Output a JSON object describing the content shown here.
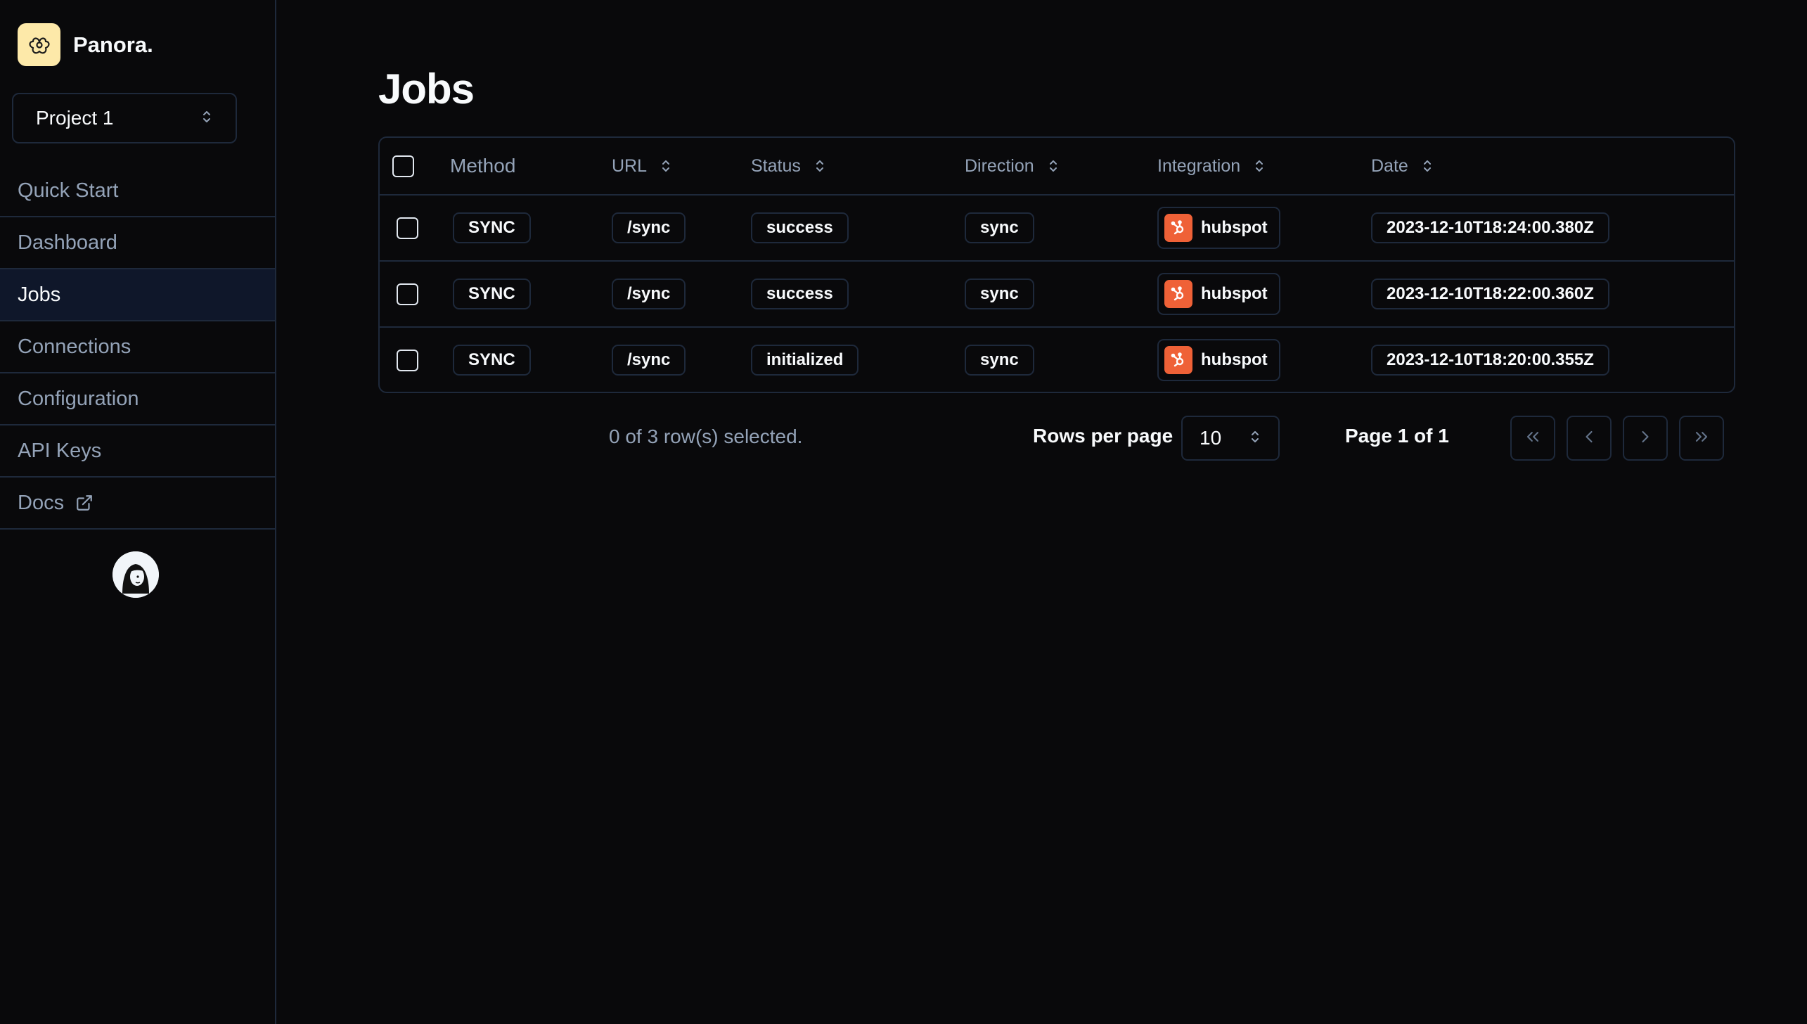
{
  "brand": {
    "name": "Panora."
  },
  "project_select": {
    "value": "Project 1"
  },
  "nav": {
    "items": [
      {
        "label": "Quick Start"
      },
      {
        "label": "Dashboard"
      },
      {
        "label": "Jobs",
        "active": true
      },
      {
        "label": "Connections"
      },
      {
        "label": "Configuration"
      },
      {
        "label": "API Keys"
      },
      {
        "label": "Docs",
        "icon": "external-link-icon"
      }
    ]
  },
  "page": {
    "title": "Jobs"
  },
  "table": {
    "columns": {
      "method": "Method",
      "url": "URL",
      "status": "Status",
      "direction": "Direction",
      "integration": "Integration",
      "date": "Date"
    },
    "rows": [
      {
        "method": "SYNC",
        "url": "/sync",
        "status": "success",
        "direction": "sync",
        "integration": "hubspot",
        "date": "2023-12-10T18:24:00.380Z"
      },
      {
        "method": "SYNC",
        "url": "/sync",
        "status": "success",
        "direction": "sync",
        "integration": "hubspot",
        "date": "2023-12-10T18:22:00.360Z"
      },
      {
        "method": "SYNC",
        "url": "/sync",
        "status": "initialized",
        "direction": "sync",
        "integration": "hubspot",
        "date": "2023-12-10T18:20:00.355Z"
      }
    ]
  },
  "footer": {
    "selected_text": "0 of 3 row(s) selected.",
    "rows_per_page_label": "Rows per page",
    "rows_per_page_value": "10",
    "page_info": "Page 1 of 1"
  },
  "colors": {
    "background": "#09090b",
    "border": "#1e293b",
    "muted_text": "#94a3b8",
    "brand_logo_bg": "#fde9a9",
    "hubspot_orange": "#ef6137",
    "active_nav_bg": "#0f172a"
  }
}
